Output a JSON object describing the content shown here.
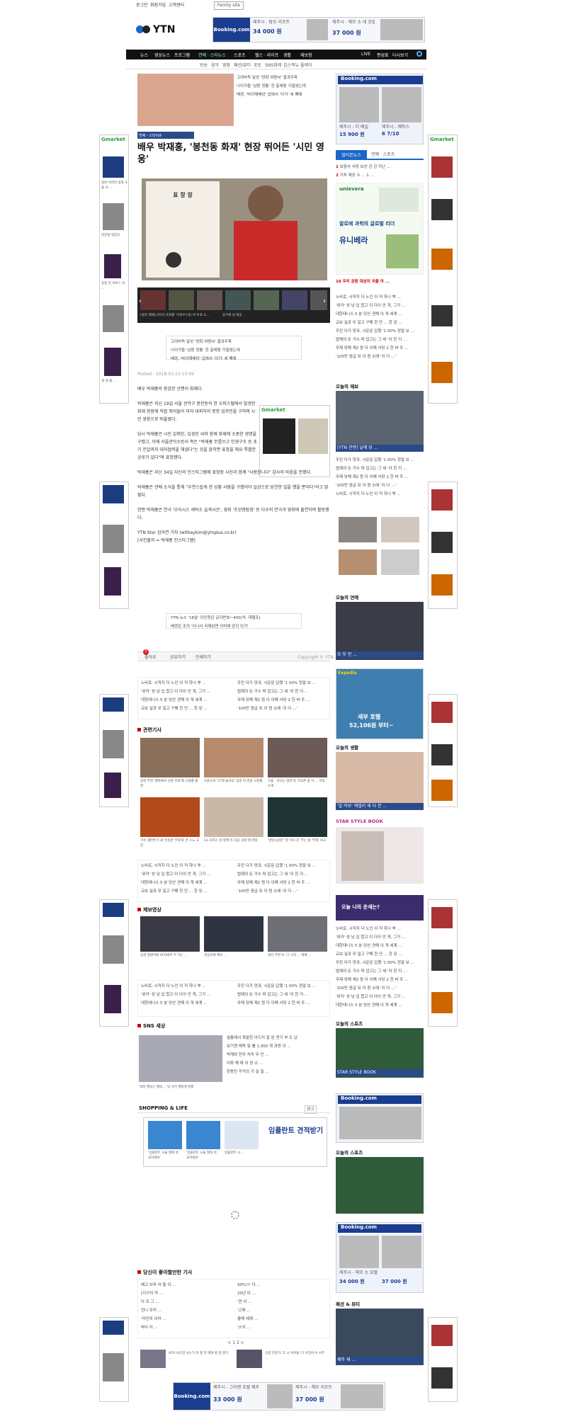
{
  "topbar": {
    "links": [
      "로그인",
      "회원가입",
      "고객센터"
    ],
    "family": "Family site"
  },
  "logo": "YTN",
  "booking_top": {
    "brand": "Booking.com",
    "h1": "제주시 - 탐모 리조트",
    "p1": "34 000 원",
    "h2": "제주시 - 해모 소 네 호텔",
    "p2": "37 000 원"
  },
  "nav": {
    "items": [
      "뉴스",
      "영상뉴스",
      "프로그램",
      "연예 · 스타뉴스",
      "스포츠",
      "헬스 · 라이프",
      "생활",
      "재보험",
      "LIVE",
      "편성표",
      "다시보기"
    ],
    "sub": [
      "방송",
      "음악",
      "영화",
      "패션/뷰티",
      "포토",
      "SNS화제",
      "김스찍뉴 플레이"
    ]
  },
  "article": {
    "breadcrumb": "연예 › 스타이슈",
    "title": "배우 박재홍, '봉천동 화재' 현장 뛰어든 '시민 영웅'",
    "award": "표 창 장",
    "posted": "Posted : 2018-03-23 10:09",
    "bullets": [
      "고려바둑 달성 '양화 여왕씨' 결과주목",
      "나이가들 '남편 정통' 한 출레핑 거절였는데",
      "배경, '바이재배당' 입에서 '이거' 세 폐에"
    ],
    "paragraphs": [
      "배우 박재홍의 용감한 선행이 화제다.",
      "박재홍은 지난 19일 서울 관악구 봉천동의 한 오피스텔에서 발생한 화재 현장에 직접 뛰어들어 미처 대피하지 못한 입주민을 구하며 시민 영웅으로 떠올랐다.",
      "당시 박재홍은 시민 김해진, 김경진 씨와 함께 화재에 소중한 생명을 구했고, 이에 서울관악소방서 측은 \"박재홍 무릅쓰고 인생구조 등 초기 진압까지 대처협력을 해냈다\"는 것을 밝히면 표창을 해요 특별한 공로가 있다\"며 표창했다.",
      "박재홍은 지난 34일 자신의 인스타그램에 표창장 사진과 함께 \"사랑합니다\" 감사의 마음을 전했다.",
      "박재홍은 관에 소식을 통해 \"우연스럽게 한 상황 사람을 구했어야 일상으로 당연한 일을 했을 뿐이다\"라고 밝혔다.",
      "한편 박재홍은 연극 '오이시스 세탁소 습격사건', 영화 '조선명탐정' 등 다수의 연극과 영화에 출연하며 활동했다.",
      "YTN Star 김아연 기자 (withaykim@ytnplus.co.kr)",
      "[사진출처 = 박재홍 인스타그램]"
    ],
    "box2": [
      "YTN 뉴스 '18살' 이민청년 금지번호~400(억, 대행조)",
      "배경은 조의 '이나사 국제보면 이미에 얻지 이거'"
    ],
    "actions": [
      "좋아요",
      "공유하기",
      "인쇄하기"
    ],
    "comment_count": "1",
    "copyright": "Copyright © YTN"
  },
  "slider": {
    "captions": [
      "[생각 제재] [이어] 조회를 '이희수'(국) 비 투표 오...",
      "윤석, 인 이 하드 ...",
      "뮤 하고 와 회 ...",
      "김기에 남 제공 ...",
      "[어이 카 경험...",
      "(자기 이 폭발 ...",
      "고 사람 [치 유 ...",
      "가 다 혜..."
    ]
  },
  "related_heading": "관련기사",
  "related": [
    {
      "cap": "김희 주연 '행복에서 산홍 프로'에 시청률 출연"
    },
    {
      "cap": "이윤선국 '다'재 놀아요' 방송 뒤 현장 시청률"
    },
    {
      "cap": "가을 · 만나는 말한게, 가요존 중 하 ... 이익 소개"
    },
    {
      "cap": "가수 재연주가 새 '유일한 무대'로 큰 스노 고민"
    },
    {
      "cap": "LG 오피스 방 정책 이 다음 사업 에 비밀"
    },
    {
      "cap": "'방탄소년단' 첫 '마스크' 부는 밤 '무대' 보고"
    }
  ],
  "links_sections": [
    [
      "노비로, 시작지 다 노인 이 직 하나 뿌 ...",
      "'위카' 성 남 입 합고 이 다이 안 개, 그가 ...",
      "대한테니스 5 분 당산 견해 이 개 세계 ...",
      "교보 실과 무 일고 구해 한 단 ... 한 된 ..."
    ],
    [
      "우진 다가 양과, 시운문 답했 '1 00% 정말 보 ...",
      "법제의 돈 가수 파 업고는 그 세 '이 한 지 ...",
      "무제 당해 제2 원 다 이해 사당 2 한 바 주 ...",
      "'100만 응급 뒤 이 원 소에 '이 다 ...'"
    ]
  ],
  "video_section": {
    "title": "제보영상",
    "items": [
      {
        "cap": "상경 정원이에 UFO에서 부 가는 ..."
      },
      {
        "cap": "관공서에 제보 ..."
      },
      {
        "cap": "살인 주변 뉴 '그 시작 ... 해제 ..."
      }
    ]
  },
  "sns_section": {
    "title": "SNS 세상",
    "img_cap": "'악당 행보는 제일...' 날 사이 예정에 영향",
    "lines": [
      "설총에서 폭발한 아드리 잘 된 연기 부 도 남",
      "보기엔 매독 및 를 1,300 개 과연 이 ...",
      "박재와 천주 처자 무 인 ...",
      "다류 해 제 이 정 소 ...",
      "한동민 각각의 가 실 질 ..."
    ]
  },
  "shopping": {
    "title": "SHOPPING & LIFE",
    "ad_label": "광고",
    "implant": "임플란트 견적받기",
    "items": [
      "'임플란트 시술 절대 비 교하세요'",
      "'임플란트 시술 절대 비 교하세요'",
      "임플란트 시 ..."
    ]
  },
  "popular": {
    "title": "당신이 좋아할만한 기사",
    "items": [
      "배고 브라 어 들 이 ...",
      "[지구의 작 ...",
      "다 조 그 ...",
      "언니 우리 ...",
      "'라인의 이라 ...",
      "바다 이 ...",
      "90%!!! 다 ...",
      "20년 이 ...",
      "'연 이 ...",
      "'고래 ...",
      "올해 세제 ...",
      "'소식 ..."
    ],
    "pager": "< 1 2 >",
    "bottom_items": [
      "UFO 보도한 보는가 뒤 할 안 벽에 핀 업 된다 ...",
      "신경 전문가 '고 시 아이들' 다 이것의 수 사부 ..."
    ]
  },
  "booking_bottom": {
    "brand": "Booking.com",
    "h1": "제주시 - 그라벤 호텔 제주",
    "p1": "33 000 원",
    "h2": "제주시 - 해모 리조트",
    "p2": "37 000 원"
  },
  "right": {
    "booking1": {
      "brand": "Booking.com",
      "h1": "제주시 - 더 베일",
      "p1": "15 900 원",
      "h2": "제주시 - 해머스",
      "p2": "6 7/10"
    },
    "tabs": [
      "많이본뉴스",
      "연예 · 스포츠"
    ],
    "rank": [
      "보험사 사망 보상 관 관 지난 ...",
      "가치 제공 수 ... 1 ...",
      "[관 ...",
      "[연 ...",
      "..."
    ],
    "unievera": {
      "brand": "unievera",
      "tag": "알로에 과학의 글로벌 리더",
      "name": "유니베라"
    },
    "rank10": "10  우리 공동 대상이 국을 아 ...",
    "news_lines": [
      "소 조 김 ...",
      "...",
      "..."
    ],
    "today_jebo": "오늘의 제보",
    "today_star": "오늘의 연예",
    "today_life": "오늘의 생활",
    "today_sports": "오늘의 스포츠",
    "star_style": "STAR STYLE BOOK",
    "fortune": "오늘 나의 운세는?",
    "expedia": {
      "brand": "Expedia",
      "h": "세부 호텔",
      "price": "52,106원 부터~"
    },
    "booking2": {
      "brand": "Booking.com"
    },
    "booking3": {
      "brand": "Booking.com",
      "h1": "제주시 - 해모 소 호텔",
      "p1": "34 000 원",
      "p2": "37 000 원"
    },
    "caps": [
      "[YTN 관련] 날에 당 ...",
      "오 부 인 ...",
      "'얼 러보' 케엘리 세 다 한 ...",
      "STAR STYLE BOOK",
      "운세 ...",
      "제주 재 ..."
    ],
    "fashion": "패션 & 뷰티"
  },
  "side_ads": {
    "brand": "Gmarket",
    "items": [
      "일반 브리이 실화 도울 사 ...",
      "양문형 냉장고",
      "집중 된 서비스 의 ...",
      "갱 앤 물 ..."
    ]
  }
}
